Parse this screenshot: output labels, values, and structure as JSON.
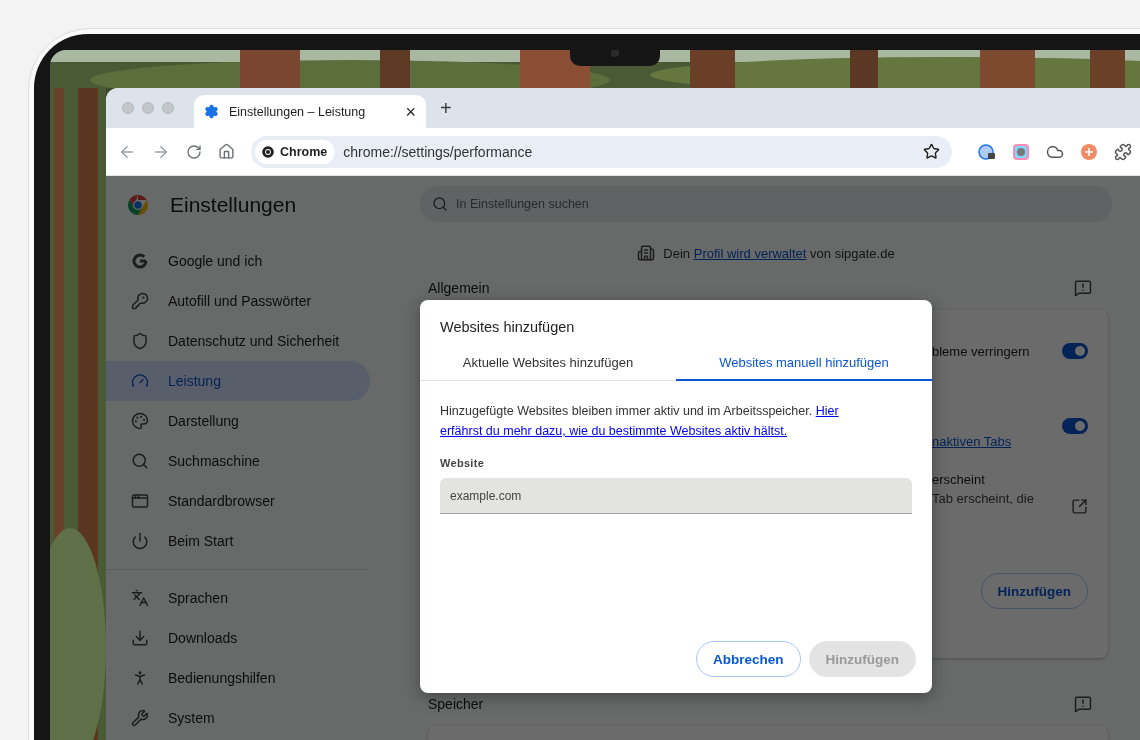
{
  "browser": {
    "tab": {
      "title": "Einstellungen – Leistung",
      "close": "×"
    },
    "new_tab": "+",
    "omnibox": {
      "chip": "Chrome",
      "url": "chrome://settings/performance"
    }
  },
  "settings": {
    "title": "Einstellungen",
    "search": {
      "placeholder": "In Einstellungen suchen"
    },
    "sidebar": {
      "groups": [
        [
          {
            "label": "Google und ich",
            "kind": "google",
            "selected": false
          },
          {
            "label": "Autofill und Passwörter",
            "kind": "key",
            "selected": false
          },
          {
            "label": "Datenschutz und Sicherheit",
            "kind": "shield",
            "selected": false
          },
          {
            "label": "Leistung",
            "kind": "gauge",
            "selected": true
          },
          {
            "label": "Darstellung",
            "kind": "palette",
            "selected": false
          },
          {
            "label": "Suchmaschine",
            "kind": "search",
            "selected": false
          },
          {
            "label": "Standardbrowser",
            "kind": "window",
            "selected": false
          },
          {
            "label": "Beim Start",
            "kind": "power",
            "selected": false
          }
        ],
        [
          {
            "label": "Sprachen",
            "kind": "translate",
            "selected": false
          },
          {
            "label": "Downloads",
            "kind": "download",
            "selected": false
          },
          {
            "label": "Bedienungshilfen",
            "kind": "accessibility",
            "selected": false
          },
          {
            "label": "System",
            "kind": "wrench",
            "selected": false
          }
        ]
      ]
    },
    "managed": {
      "before": "Dein",
      "link": "Profil wird verwaltet",
      "after": "von sipgate.de"
    },
    "sections": [
      {
        "title": "Allgemein",
        "rows": [
          {
            "kind": "toggle",
            "text": "bleme verringern",
            "on": true
          },
          {
            "kind": "toggle-link",
            "link": "naktiven Tabs",
            "on": true
          },
          {
            "kind": "external",
            "lines": [
              "erscheint",
              "Tab erscheint, die"
            ]
          },
          {
            "kind": "button",
            "label": "Hinzufügen"
          }
        ]
      },
      {
        "title": "Speicher"
      }
    ]
  },
  "dialog": {
    "title": "Websites hinzufügen",
    "tabs": [
      {
        "label": "Aktuelle Websites hinzufügen",
        "selected": false
      },
      {
        "label": "Websites manuell hinzufügen",
        "selected": true
      }
    ],
    "description": "Hinzugefügte Websites bleiben immer aktiv und im Arbeitsspeicher.",
    "link_lines": [
      "Hier",
      "erfährst du mehr dazu, wie du bestimmte Websites aktiv hältst."
    ],
    "field": {
      "label": "Website",
      "placeholder": "example.com"
    },
    "buttons": [
      {
        "label": "Abbrechen",
        "disabled": false
      },
      {
        "label": "Hinzufügen",
        "disabled": true
      }
    ]
  }
}
